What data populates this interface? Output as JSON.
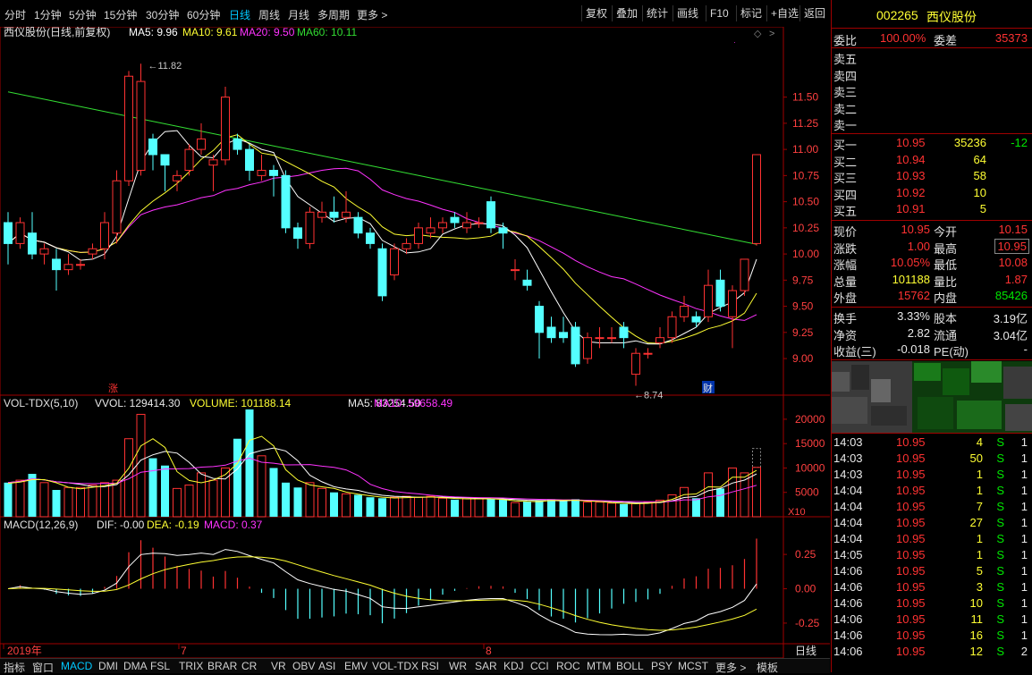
{
  "toolbar": {
    "periods": [
      "分时",
      "1分钟",
      "5分钟",
      "15分钟",
      "30分钟",
      "60分钟",
      "日线",
      "周线",
      "月线",
      "多周期",
      "更多 >"
    ],
    "active_period": "日线",
    "buttons": [
      "复权",
      "叠加",
      "统计",
      "画线",
      "F10",
      "标记",
      "+自选",
      "返回"
    ]
  },
  "main_chart": {
    "title": "西仪股份(日线,前复权)",
    "ma_labels": [
      {
        "text": "MA5: 9.96",
        "color": "#ffffff"
      },
      {
        "text": "MA10: 9.61",
        "color": "#ffff33"
      },
      {
        "text": "MA20: 9.50",
        "color": "#ff33ff"
      },
      {
        "text": "MA60: 10.11",
        "color": "#33dd33"
      }
    ],
    "y_ticks": [
      "11.50",
      "11.25",
      "11.00",
      "10.75",
      "10.50",
      "10.25",
      "10.00",
      "9.75",
      "9.50",
      "9.25",
      "9.00"
    ],
    "y_range": [
      8.65,
      11.95
    ],
    "high_note": "11.82",
    "low_note": "8.74",
    "markers": [
      {
        "text": "涨",
        "color": "#ff3232"
      },
      {
        "text": "财",
        "color": "#e8e8e8"
      }
    ]
  },
  "candles": [
    {
      "o": 10.3,
      "c": 10.1,
      "h": 10.4,
      "l": 9.9
    },
    {
      "o": 10.1,
      "c": 10.3,
      "h": 10.35,
      "l": 10.05
    },
    {
      "o": 10.2,
      "c": 10.0,
      "h": 10.4,
      "l": 9.95
    },
    {
      "o": 10.0,
      "c": 10.05,
      "h": 10.1,
      "l": 9.9
    },
    {
      "o": 9.95,
      "c": 9.85,
      "h": 10.05,
      "l": 9.65
    },
    {
      "o": 9.85,
      "c": 9.9,
      "h": 10.0,
      "l": 9.8
    },
    {
      "o": 9.9,
      "c": 9.9,
      "h": 9.95,
      "l": 9.85
    },
    {
      "o": 10.0,
      "c": 10.05,
      "h": 10.1,
      "l": 9.95
    },
    {
      "o": 10.05,
      "c": 10.3,
      "h": 10.4,
      "l": 9.95
    },
    {
      "o": 10.2,
      "c": 10.7,
      "h": 10.8,
      "l": 10.1
    },
    {
      "o": 10.7,
      "c": 11.7,
      "h": 11.75,
      "l": 10.65
    },
    {
      "o": 10.8,
      "c": 11.65,
      "h": 11.82,
      "l": 10.75
    },
    {
      "o": 11.1,
      "c": 10.95,
      "h": 11.15,
      "l": 10.8
    },
    {
      "o": 10.95,
      "c": 10.85,
      "h": 10.95,
      "l": 10.6
    },
    {
      "o": 10.7,
      "c": 10.75,
      "h": 10.8,
      "l": 10.6
    },
    {
      "o": 10.8,
      "c": 11.0,
      "h": 11.05,
      "l": 10.75
    },
    {
      "o": 11.0,
      "c": 11.1,
      "h": 11.25,
      "l": 10.95
    },
    {
      "o": 10.85,
      "c": 10.9,
      "h": 10.95,
      "l": 10.6
    },
    {
      "o": 10.9,
      "c": 11.5,
      "h": 11.6,
      "l": 10.85
    },
    {
      "o": 11.1,
      "c": 11.0,
      "h": 11.15,
      "l": 10.95
    },
    {
      "o": 11.0,
      "c": 10.8,
      "h": 11.05,
      "l": 10.7
    },
    {
      "o": 10.75,
      "c": 10.8,
      "h": 10.95,
      "l": 10.7
    },
    {
      "o": 10.8,
      "c": 10.75,
      "h": 10.85,
      "l": 10.55
    },
    {
      "o": 10.75,
      "c": 10.25,
      "h": 10.8,
      "l": 10.2
    },
    {
      "o": 10.25,
      "c": 10.15,
      "h": 10.3,
      "l": 10.05
    },
    {
      "o": 10.1,
      "c": 10.4,
      "h": 10.45,
      "l": 10.05
    },
    {
      "o": 10.35,
      "c": 10.4,
      "h": 10.5,
      "l": 10.3
    },
    {
      "o": 10.4,
      "c": 10.35,
      "h": 10.55,
      "l": 10.3
    },
    {
      "o": 10.35,
      "c": 10.4,
      "h": 10.6,
      "l": 10.3
    },
    {
      "o": 10.35,
      "c": 10.2,
      "h": 10.4,
      "l": 10.15
    },
    {
      "o": 10.2,
      "c": 10.1,
      "h": 10.25,
      "l": 10.05
    },
    {
      "o": 10.05,
      "c": 9.6,
      "h": 10.1,
      "l": 9.55
    },
    {
      "o": 9.8,
      "c": 10.05,
      "h": 10.1,
      "l": 9.75
    },
    {
      "o": 10.05,
      "c": 10.1,
      "h": 10.15,
      "l": 10.0
    },
    {
      "o": 10.1,
      "c": 10.25,
      "h": 10.3,
      "l": 10.05
    },
    {
      "o": 10.2,
      "c": 10.25,
      "h": 10.35,
      "l": 10.15
    },
    {
      "o": 10.25,
      "c": 10.3,
      "h": 10.35,
      "l": 10.2
    },
    {
      "o": 10.35,
      "c": 10.3,
      "h": 10.4,
      "l": 10.25
    },
    {
      "o": 10.25,
      "c": 10.3,
      "h": 10.4,
      "l": 10.2
    },
    {
      "o": 10.3,
      "c": 10.3,
      "h": 10.35,
      "l": 10.25
    },
    {
      "o": 10.5,
      "c": 10.25,
      "h": 10.55,
      "l": 10.2
    },
    {
      "o": 10.25,
      "c": 10.2,
      "h": 10.3,
      "l": 10.05
    },
    {
      "o": 9.85,
      "c": 9.85,
      "h": 9.95,
      "l": 9.75
    },
    {
      "o": 9.75,
      "c": 9.7,
      "h": 9.85,
      "l": 9.65
    },
    {
      "o": 9.5,
      "c": 9.25,
      "h": 9.55,
      "l": 9.0
    },
    {
      "o": 9.3,
      "c": 9.2,
      "h": 9.4,
      "l": 9.15
    },
    {
      "o": 9.25,
      "c": 9.2,
      "h": 9.4,
      "l": 9.15
    },
    {
      "o": 9.3,
      "c": 8.95,
      "h": 9.35,
      "l": 8.92
    },
    {
      "o": 9.0,
      "c": 9.2,
      "h": 9.25,
      "l": 8.95
    },
    {
      "o": 9.2,
      "c": 9.2,
      "h": 9.3,
      "l": 9.1
    },
    {
      "o": 9.2,
      "c": 9.2,
      "h": 9.3,
      "l": 9.15
    },
    {
      "o": 9.3,
      "c": 9.2,
      "h": 9.35,
      "l": 9.1
    },
    {
      "o": 8.85,
      "c": 9.05,
      "h": 9.1,
      "l": 8.74
    },
    {
      "o": 9.05,
      "c": 9.05,
      "h": 9.1,
      "l": 9.0
    },
    {
      "o": 9.15,
      "c": 9.2,
      "h": 9.3,
      "l": 9.1
    },
    {
      "o": 9.2,
      "c": 9.4,
      "h": 9.45,
      "l": 9.15
    },
    {
      "o": 9.4,
      "c": 9.5,
      "h": 9.6,
      "l": 9.35
    },
    {
      "o": 9.4,
      "c": 9.35,
      "h": 9.45,
      "l": 9.3
    },
    {
      "o": 9.4,
      "c": 9.7,
      "h": 9.85,
      "l": 9.35
    },
    {
      "o": 9.75,
      "c": 9.5,
      "h": 9.85,
      "l": 9.45
    },
    {
      "o": 9.4,
      "c": 9.65,
      "h": 9.7,
      "l": 9.1
    },
    {
      "o": 9.65,
      "c": 9.95,
      "h": 9.95,
      "l": 9.6
    },
    {
      "o": 10.1,
      "c": 10.95,
      "h": 10.95,
      "l": 10.08
    }
  ],
  "volume": {
    "title": "VOL-TDX(5,10)",
    "labels": [
      {
        "text": "VVOL: 129414.30",
        "color": "#e8e8e8"
      },
      {
        "text": "VOLUME: 101188.14",
        "color": "#ffff33"
      },
      {
        "text": "MA5: 83254.50",
        "color": "#e8e8e8"
      },
      {
        "text": "MA10: 59658.49",
        "color": "#ff33ff"
      }
    ],
    "y_ticks": [
      "20000",
      "15000",
      "10000",
      "5000"
    ],
    "unit": "X10",
    "y_max": 22000,
    "values": [
      7000,
      7500,
      8800,
      7000,
      5500,
      6000,
      6000,
      6500,
      7000,
      7500,
      16000,
      21000,
      12000,
      10500,
      5800,
      6500,
      9000,
      7500,
      10000,
      16000,
      22000,
      12500,
      10000,
      7000,
      6000,
      7000,
      5800,
      5000,
      4700,
      4500,
      4000,
      3800,
      4000,
      4200,
      4000,
      4200,
      3800,
      3500,
      3900,
      3800,
      3600,
      3500,
      2900,
      3200,
      3400,
      3600,
      3200,
      3600,
      3000,
      3000,
      2800,
      2600,
      2800,
      3000,
      3400,
      4500,
      6000,
      3800,
      9000,
      5800,
      10000,
      9000,
      10119
    ]
  },
  "macd": {
    "title": "MACD(12,26,9)",
    "labels": [
      {
        "text": "DIF: -0.00",
        "color": "#e8e8e8"
      },
      {
        "text": "DEA: -0.19",
        "color": "#ffff33"
      },
      {
        "text": "MACD: 0.37",
        "color": "#ff33ff"
      }
    ],
    "y_ticks": [
      "0.25",
      "0.00",
      "-0.25"
    ],
    "y_range": [
      -0.4,
      0.42
    ]
  },
  "x_labels": [
    "2019年",
    "7",
    "8"
  ],
  "x_corner": "日线",
  "bottom_tabs": [
    "指标",
    "窗口",
    "MACD",
    "DMI",
    "DMA",
    "FSL",
    "TRIX",
    "BRAR",
    "CR",
    "VR",
    "OBV",
    "ASI",
    "EMV",
    "VOL-TDX",
    "RSI",
    "WR",
    "SAR",
    "KDJ",
    "CCI",
    "ROC",
    "MTM",
    "BOLL",
    "PSY",
    "MCST",
    "更多 >",
    "模板"
  ],
  "bottom_active": "MACD",
  "quote": {
    "code": "002265",
    "name": "西仪股份",
    "weibi_label": "委比",
    "weibi": "100.00%",
    "weicha_label": "委差",
    "weicha": "35373",
    "sells": [
      {
        "label": "卖五"
      },
      {
        "label": "卖四"
      },
      {
        "label": "卖三"
      },
      {
        "label": "卖二"
      },
      {
        "label": "卖一"
      }
    ],
    "buys": [
      {
        "label": "买一",
        "price": "10.95",
        "vol": "35236",
        "chg": "-12"
      },
      {
        "label": "买二",
        "price": "10.94",
        "vol": "64",
        "chg": ""
      },
      {
        "label": "买三",
        "price": "10.93",
        "vol": "58",
        "chg": ""
      },
      {
        "label": "买四",
        "price": "10.92",
        "vol": "10",
        "chg": ""
      },
      {
        "label": "买五",
        "price": "10.91",
        "vol": "5",
        "chg": ""
      }
    ],
    "stats": [
      {
        "l1": "现价",
        "v1": "10.95",
        "c1": "red",
        "l2": "今开",
        "v2": "10.15",
        "c2": "red"
      },
      {
        "l1": "涨跌",
        "v1": "1.00",
        "c1": "red",
        "l2": "最高",
        "v2": "10.95",
        "c2": "red"
      },
      {
        "l1": "涨幅",
        "v1": "10.05%",
        "c1": "red",
        "l2": "最低",
        "v2": "10.08",
        "c2": "red"
      },
      {
        "l1": "总量",
        "v1": "101188",
        "c1": "yellow",
        "l2": "量比",
        "v2": "1.87",
        "c2": "red"
      },
      {
        "l1": "外盘",
        "v1": "15762",
        "c1": "red",
        "l2": "内盘",
        "v2": "85426",
        "c2": "green"
      }
    ],
    "stats2": [
      {
        "l1": "换手",
        "v1": "3.33%",
        "l2": "股本",
        "v2": "3.19亿"
      },
      {
        "l1": "净资",
        "v1": "2.82",
        "l2": "流通",
        "v2": "3.04亿"
      },
      {
        "l1": "收益(三)",
        "v1": "-0.018",
        "l2": "PE(动)",
        "v2": "-"
      }
    ],
    "ticks": [
      {
        "t": "14:03",
        "p": "10.95",
        "v": "4",
        "d": "S",
        "n": "1"
      },
      {
        "t": "14:03",
        "p": "10.95",
        "v": "50",
        "d": "S",
        "n": "1"
      },
      {
        "t": "14:03",
        "p": "10.95",
        "v": "1",
        "d": "S",
        "n": "1"
      },
      {
        "t": "14:04",
        "p": "10.95",
        "v": "1",
        "d": "S",
        "n": "1"
      },
      {
        "t": "14:04",
        "p": "10.95",
        "v": "7",
        "d": "S",
        "n": "1"
      },
      {
        "t": "14:04",
        "p": "10.95",
        "v": "27",
        "d": "S",
        "n": "1"
      },
      {
        "t": "14:04",
        "p": "10.95",
        "v": "1",
        "d": "S",
        "n": "1"
      },
      {
        "t": "14:05",
        "p": "10.95",
        "v": "1",
        "d": "S",
        "n": "1"
      },
      {
        "t": "14:06",
        "p": "10.95",
        "v": "5",
        "d": "S",
        "n": "1"
      },
      {
        "t": "14:06",
        "p": "10.95",
        "v": "3",
        "d": "S",
        "n": "1"
      },
      {
        "t": "14:06",
        "p": "10.95",
        "v": "10",
        "d": "S",
        "n": "1"
      },
      {
        "t": "14:06",
        "p": "10.95",
        "v": "11",
        "d": "S",
        "n": "1"
      },
      {
        "t": "14:06",
        "p": "10.95",
        "v": "16",
        "d": "S",
        "n": "1"
      },
      {
        "t": "14:06",
        "p": "10.95",
        "v": "12",
        "d": "S",
        "n": "2"
      }
    ]
  }
}
